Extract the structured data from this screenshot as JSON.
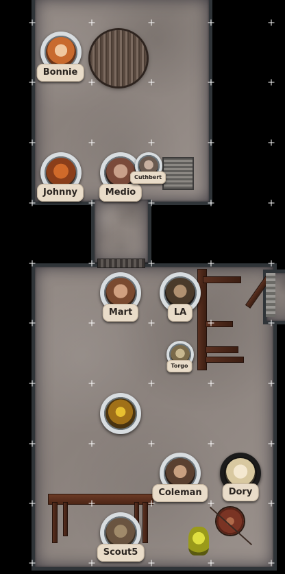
{
  "map": {
    "tokens": [
      {
        "id": "bonnie",
        "label": "Bonnie",
        "style": "normal"
      },
      {
        "id": "johnny",
        "label": "Johnny",
        "style": "normal"
      },
      {
        "id": "medio",
        "label": "Medio",
        "style": "normal"
      },
      {
        "id": "cuthbert",
        "label": "Cuthbert",
        "style": "small"
      },
      {
        "id": "mart",
        "label": "Mart",
        "style": "normal"
      },
      {
        "id": "la",
        "label": "LA",
        "style": "normal"
      },
      {
        "id": "torgo",
        "label": "Torgo",
        "style": "small"
      },
      {
        "id": "monster",
        "label": "",
        "style": "normal"
      },
      {
        "id": "coleman",
        "label": "Coleman",
        "style": "normal"
      },
      {
        "id": "dory",
        "label": "Dory",
        "style": "dark"
      },
      {
        "id": "scout5",
        "label": "Scout5",
        "style": "normal"
      }
    ],
    "colors": {
      "background": "#000000",
      "floor": "#8f8681",
      "wall": "#2f3438",
      "label_bg": "#e9dcc9",
      "label_text": "#2a2420",
      "grid_marker": "#ffffff"
    },
    "icons": {
      "barrel": "round-wooden-barrel-top",
      "furniture": "wooden-table",
      "shield": "round-shield-with-spear",
      "idol": "yellow-idol"
    }
  }
}
